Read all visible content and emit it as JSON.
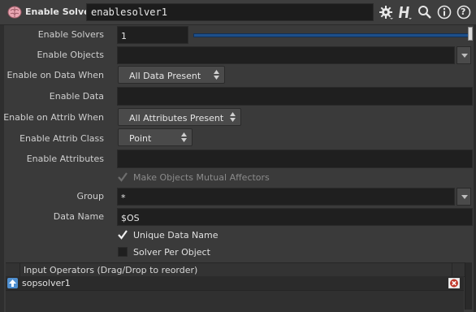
{
  "header": {
    "node_type_label": "Enable Solver",
    "node_name": "enablesolver1",
    "help_button_label": "?"
  },
  "params": {
    "enable_solvers": {
      "label": "Enable Solvers",
      "value": "1",
      "slider_fraction": 1.0
    },
    "enable_objects": {
      "label": "Enable Objects",
      "value": ""
    },
    "enable_on_data_when": {
      "label": "Enable on Data When",
      "selected": "All Data Present"
    },
    "enable_data": {
      "label": "Enable Data",
      "value": ""
    },
    "enable_on_attrib_when": {
      "label": "Enable on Attrib When",
      "selected": "All Attributes Present"
    },
    "enable_attrib_class": {
      "label": "Enable Attrib Class",
      "selected": "Point"
    },
    "enable_attributes": {
      "label": "Enable Attributes",
      "value": ""
    },
    "make_objects_mutual_affectors": {
      "label": "Make Objects Mutual Affectors",
      "checked": true,
      "disabled": true
    },
    "group": {
      "label": "Group",
      "value": "*"
    },
    "data_name": {
      "label": "Data Name",
      "value": "$OS"
    },
    "unique_data_name": {
      "label": "Unique Data Name",
      "checked": true
    },
    "solver_per_object": {
      "label": "Solver Per Object",
      "checked": false
    }
  },
  "input_operators": {
    "header": "Input Operators (Drag/Drop to reorder)",
    "rows": [
      {
        "name": "sopsolver1"
      }
    ]
  },
  "colors": {
    "slider_accent": "#2a6bb5",
    "remove_red": "#c0392b"
  }
}
